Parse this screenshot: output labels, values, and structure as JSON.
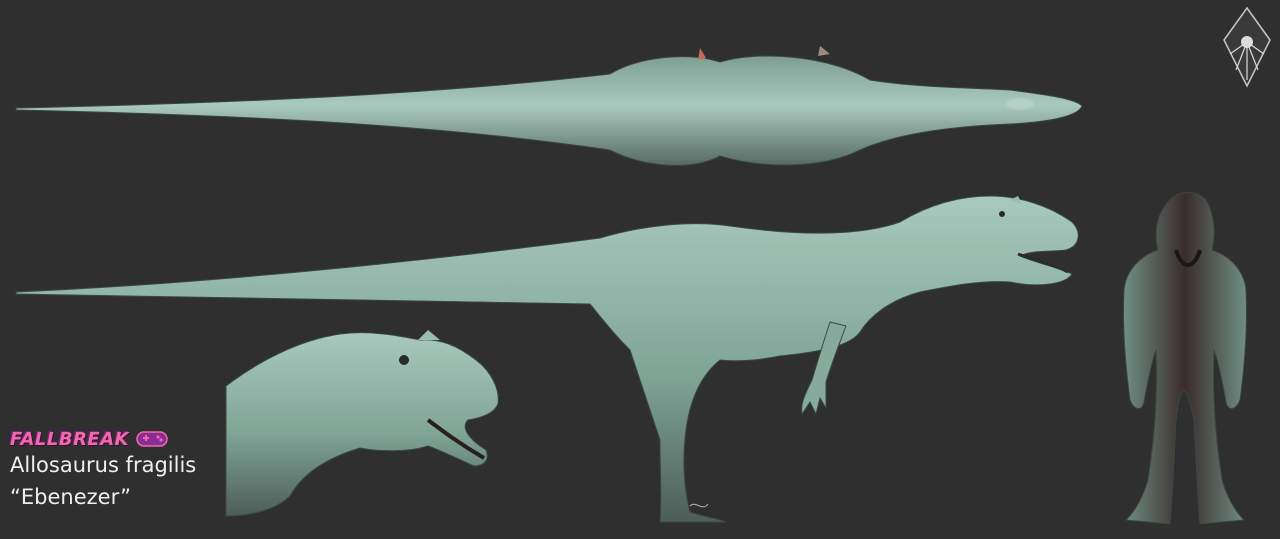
{
  "caption": {
    "brand": "FALLBREAK",
    "species": "Allosaurus fragilis",
    "nickname": "“Ebenezer”"
  },
  "views": [
    {
      "id": "top",
      "icon": "dinosaur-top-view"
    },
    {
      "id": "side",
      "icon": "dinosaur-side-view"
    },
    {
      "id": "head",
      "icon": "dinosaur-head-closeup"
    },
    {
      "id": "front",
      "icon": "dinosaur-front-view"
    }
  ],
  "colors": {
    "background": "#2f2f30",
    "skin": "#8fb7a8",
    "skin_shadow": "#4f5f5a",
    "brand": "#f06aa8"
  }
}
